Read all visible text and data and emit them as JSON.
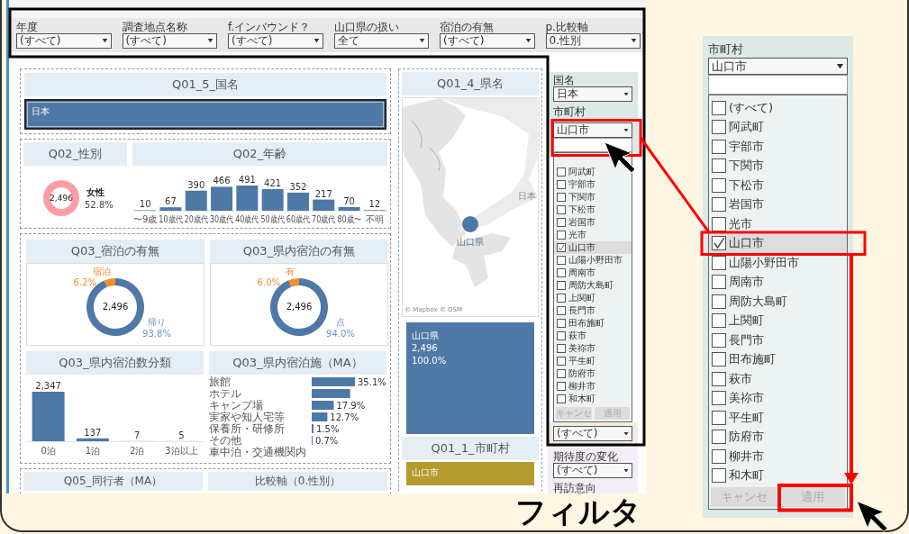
{
  "filter_bar": [
    {
      "label": "年度",
      "value": "(すべて)"
    },
    {
      "label": "調査地点名称",
      "value": "(すべて)"
    },
    {
      "label": "f.インバウンド？",
      "value": "(すべて)"
    },
    {
      "label": "山口県の扱い",
      "value": "全て"
    },
    {
      "label": "宿泊の有無",
      "value": "(すべて)"
    },
    {
      "label": "p.比較軸",
      "value": "0.性別"
    }
  ],
  "country_panel": {
    "title": "Q01_5_国名",
    "bar_label": "日本"
  },
  "gender_panel": {
    "title": "Q02_性別",
    "center_label": "2,496",
    "slice_label": "女性",
    "share_label": "52.8%"
  },
  "age_panel": {
    "title": "Q02_年齢",
    "chart_data": {
      "type": "bar",
      "categories": [
        "〜9歳",
        "10歳代",
        "20歳代",
        "30歳代",
        "40歳代",
        "50歳代",
        "60歳代",
        "70歳代",
        "80歳〜",
        "不明"
      ],
      "values": [
        10,
        67,
        390,
        466,
        491,
        421,
        352,
        217,
        70,
        12
      ],
      "data_labels": true
    }
  },
  "stay_panel": {
    "title": "Q03_宿泊の有無",
    "center_label": "2,496",
    "chart_data": {
      "type": "donut",
      "categories": [
        "宿泊",
        "帰り"
      ],
      "values": [
        6.2,
        93.8
      ],
      "colors": [
        "#f28e2b",
        "#4e79a7"
      ],
      "value_labels": [
        "6.2%",
        "93.8%"
      ]
    }
  },
  "pref_stay_panel": {
    "title": "Q03_県内宿泊の有無",
    "center_label": "2,496",
    "chart_data": {
      "type": "donut",
      "categories": [
        "有",
        "点"
      ],
      "values": [
        6.0,
        94.0
      ],
      "colors": [
        "#f28e2b",
        "#4e79a7"
      ],
      "value_labels": [
        "6.0%",
        "94.0%"
      ]
    }
  },
  "nights_panel": {
    "title": "Q03_県内宿泊数分類",
    "chart_data": {
      "type": "bar",
      "categories": [
        "0泊",
        "1泊",
        "2泊",
        "3泊以上"
      ],
      "values": [
        2347,
        137,
        7,
        5
      ],
      "value_labels": [
        "2,347",
        "137",
        "7",
        "5"
      ]
    }
  },
  "facility_panel": {
    "title": "Q03_県内宿泊施（MA）",
    "chart_data": {
      "type": "bar",
      "orientation": "horizontal",
      "categories": [
        "旅館",
        "ホテル",
        "キャンプ場",
        "実家や知人宅等",
        "保養所・研修所",
        "その他",
        "車中泊・交通機関内"
      ],
      "values": [
        35.1,
        31.2,
        17.9,
        12.7,
        1.5,
        0.7,
        null
      ],
      "value_labels": [
        "35.1%",
        null,
        "17.9%",
        "12.7%",
        "1.5%",
        "0.7%",
        null
      ]
    }
  },
  "bottom_titles": [
    "Q05_同行者（MA）",
    "比較軸（0.性別）"
  ],
  "map_panel": {
    "title": "Q01_4_県名",
    "marker_label": "山口県",
    "country_label": "日本",
    "attribution": "© Mapbox © OSM"
  },
  "treemap": {
    "lines": [
      "山口県",
      "2,496",
      "100.0%"
    ]
  },
  "city_panel": {
    "title": "Q01_1_市町村",
    "bar_label": "山口市"
  },
  "filter_panel": {
    "country": {
      "label": "国名",
      "value": "日本"
    },
    "city": {
      "label": "市町村",
      "value": "山口市",
      "items": [
        {
          "label": "阿武町",
          "checked": false,
          "selected": false
        },
        {
          "label": "宇部市",
          "checked": false,
          "selected": false
        },
        {
          "label": "下関市",
          "checked": false,
          "selected": false
        },
        {
          "label": "下松市",
          "checked": false,
          "selected": false
        },
        {
          "label": "岩国市",
          "checked": false,
          "selected": false
        },
        {
          "label": "光市",
          "checked": false,
          "selected": false
        },
        {
          "label": "山口市",
          "checked": true,
          "selected": true
        },
        {
          "label": "山陽小野田市",
          "checked": false,
          "selected": false
        },
        {
          "label": "周南市",
          "checked": false,
          "selected": false
        },
        {
          "label": "周防大島町",
          "checked": false,
          "selected": false
        },
        {
          "label": "上関町",
          "checked": false,
          "selected": false
        },
        {
          "label": "長門市",
          "checked": false,
          "selected": false
        },
        {
          "label": "田布施町",
          "checked": false,
          "selected": false
        },
        {
          "label": "萩市",
          "checked": false,
          "selected": false
        },
        {
          "label": "美祢市",
          "checked": false,
          "selected": false
        },
        {
          "label": "平生町",
          "checked": false,
          "selected": false
        },
        {
          "label": "防府市",
          "checked": false,
          "selected": false
        },
        {
          "label": "柳井市",
          "checked": false,
          "selected": false
        },
        {
          "label": "和木町",
          "checked": false,
          "selected": false
        }
      ],
      "buttons": [
        {
          "label": "キャンセ",
          "disabled": true
        },
        {
          "label": "適用",
          "disabled": true
        }
      ]
    },
    "next_select": "(すべて)",
    "expectation": {
      "label": "期待度の変化",
      "value": "(すべて)"
    },
    "revisit_label": "再訪意向"
  },
  "zoom_panel": {
    "label": "市町村",
    "value": "山口市",
    "items": [
      {
        "label": "(すべて)",
        "checked": false,
        "selected": false
      },
      {
        "label": "阿武町",
        "checked": false,
        "selected": false
      },
      {
        "label": "宇部市",
        "checked": false,
        "selected": false
      },
      {
        "label": "下関市",
        "checked": false,
        "selected": false
      },
      {
        "label": "下松市",
        "checked": false,
        "selected": false
      },
      {
        "label": "岩国市",
        "checked": false,
        "selected": false
      },
      {
        "label": "光市",
        "checked": false,
        "selected": false
      },
      {
        "label": "山口市",
        "checked": true,
        "selected": true
      },
      {
        "label": "山陽小野田市",
        "checked": false,
        "selected": false
      },
      {
        "label": "周南市",
        "checked": false,
        "selected": false
      },
      {
        "label": "周防大島町",
        "checked": false,
        "selected": false
      },
      {
        "label": "上関町",
        "checked": false,
        "selected": false
      },
      {
        "label": "長門市",
        "checked": false,
        "selected": false
      },
      {
        "label": "田布施町",
        "checked": false,
        "selected": false
      },
      {
        "label": "萩市",
        "checked": false,
        "selected": false
      },
      {
        "label": "美祢市",
        "checked": false,
        "selected": false
      },
      {
        "label": "平生町",
        "checked": false,
        "selected": false
      },
      {
        "label": "防府市",
        "checked": false,
        "selected": false
      },
      {
        "label": "柳井市",
        "checked": false,
        "selected": false
      },
      {
        "label": "和木町",
        "checked": false,
        "selected": false
      }
    ],
    "buttons": [
      {
        "label": "キャンセ",
        "disabled": true
      },
      {
        "label": "適用",
        "disabled": true
      }
    ]
  },
  "caption": "フィルタ"
}
